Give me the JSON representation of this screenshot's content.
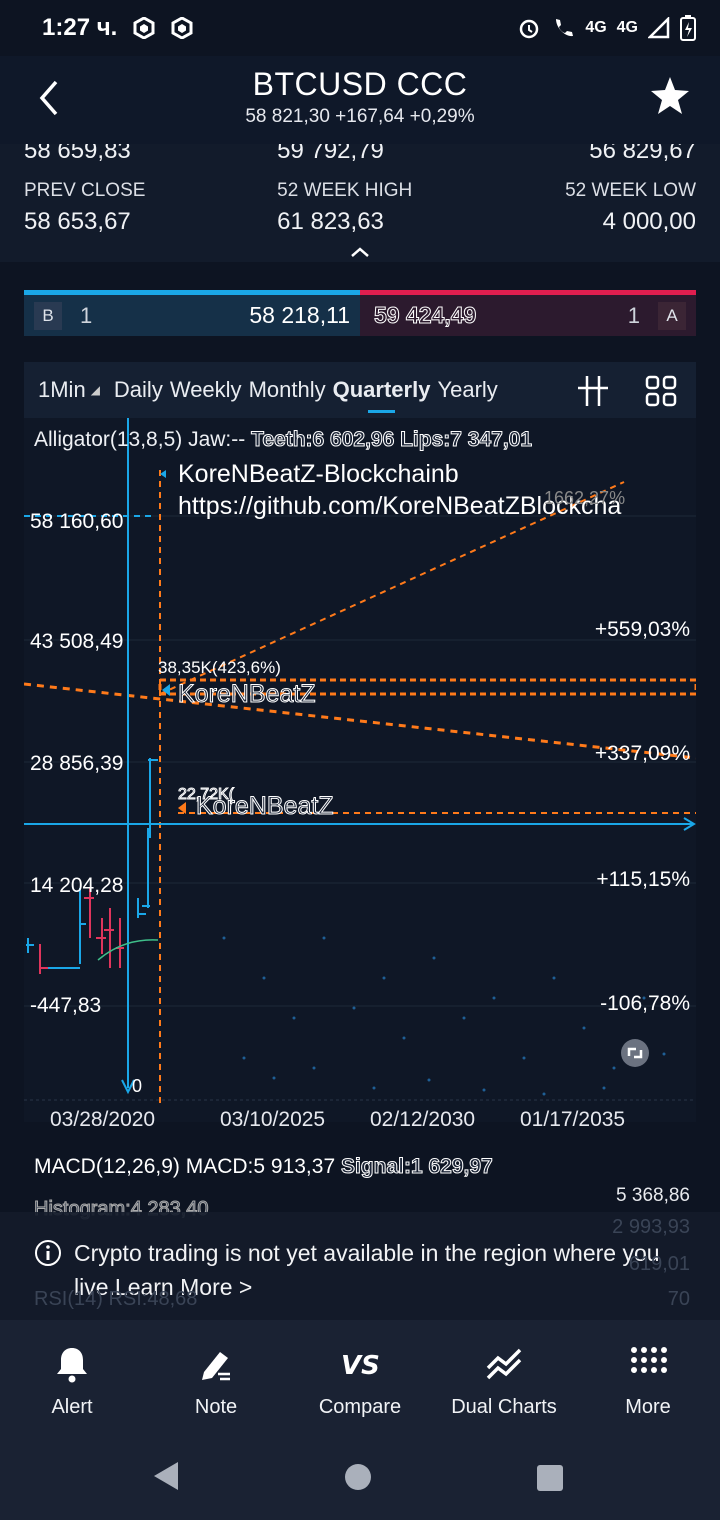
{
  "status": {
    "time": "1:27 ч.",
    "network": "4G",
    "network2": "4G"
  },
  "header": {
    "title": "BTCUSD CCC",
    "subtitle": "58 821,30 +167,64 +0,29%"
  },
  "stats": {
    "row1": [
      "58 659,83",
      "59 792,79",
      "56 829,67"
    ],
    "row2_labels": [
      "PREV CLOSE",
      "52 WEEK HIGH",
      "52 WEEK LOW"
    ],
    "row2_values": [
      "58 653,67",
      "61 823,63",
      "4 000,00"
    ]
  },
  "bidask": {
    "bid_box": "B",
    "bid_qty": "1",
    "bid_price": "58 218,11",
    "ask_price": "59 424,49",
    "ask_qty": "1",
    "ask_box": "A"
  },
  "timeframes": {
    "interval": "1Min",
    "items": [
      "Daily",
      "Weekly",
      "Monthly",
      "Quarterly",
      "Yearly"
    ],
    "active": "Quarterly"
  },
  "indicator": {
    "text": "Alligator(13,8,5) Jaw:-- ",
    "teeth": "Teeth:6 602,96",
    "lips": "Lips:7 347,01"
  },
  "chart_labels": {
    "y_left": [
      "58 160,60",
      "43 508,49",
      "28 856,39",
      "14 204,28",
      "-447,83"
    ],
    "y_right": [
      "+559,03%",
      "+337,09%",
      "+115,15%",
      "-106,78%"
    ],
    "zero": "0",
    "annotation1": "KoreNBeatZ-Blockchainb",
    "annotation2": "https://github.com/KoreNBeatZBlockcha",
    "annotation3": "KoreNBeatZ",
    "annotation4": "KoreNBeatZ",
    "marker1": "38,35K(423,6%)",
    "marker2": "22,72K(",
    "top_right_fragment": "1662,27%"
  },
  "x_axis": [
    "03/28/2020",
    "03/10/2025",
    "02/12/2030",
    "01/17/2035"
  ],
  "macd": {
    "text": "MACD(12,26,9) MACD:5 913,37 ",
    "signal": "Signal:1 629,97",
    "histogram": "Histogram:4 283,40",
    "right1": "5 368,86",
    "right2": "2 993,93",
    "right3": "619,01",
    "rsi": "RSI(14) RSI:48,68",
    "rsi_right": "70"
  },
  "toast": {
    "message": "Crypto trading is not yet available in the region where you live.Learn More >"
  },
  "nav": [
    "Alert",
    "Note",
    "Compare",
    "Dual Charts",
    "More"
  ],
  "colors": {
    "accent_blue": "#1aa7e8",
    "ask_red": "#e01e4f",
    "orange": "#ff7a1a",
    "bg": "#0d1422"
  }
}
